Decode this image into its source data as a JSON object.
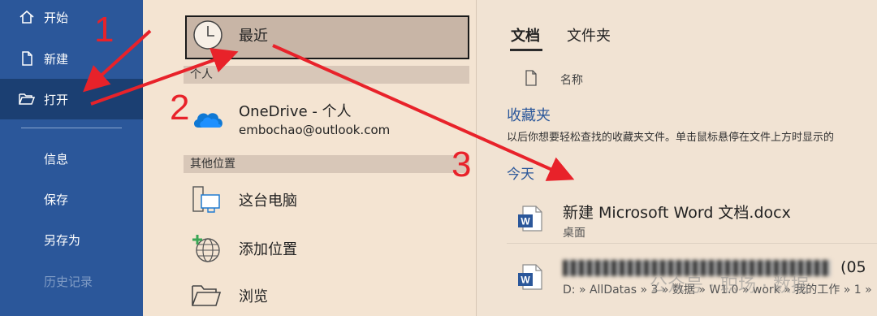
{
  "sidebar": {
    "items": [
      {
        "label": "开始",
        "icon": "home-icon"
      },
      {
        "label": "新建",
        "icon": "new-document-icon"
      },
      {
        "label": "打开",
        "icon": "open-folder-icon",
        "active": true
      }
    ],
    "sub_items": [
      {
        "label": "信息"
      },
      {
        "label": "保存"
      },
      {
        "label": "另存为"
      },
      {
        "label": "历史记录",
        "disabled": true
      }
    ]
  },
  "locations": {
    "recent_label": "最近",
    "personal_header": "个人",
    "onedrive": {
      "label": "OneDrive - 个人",
      "account": "embochao@outlook.com"
    },
    "other_header": "其他位置",
    "this_pc": "这台电脑",
    "add_place": "添加位置",
    "browse": "浏览"
  },
  "right": {
    "tabs": [
      "文档",
      "文件夹"
    ],
    "column_name": "名称",
    "favorites_title": "收藏夹",
    "favorites_desc": "以后你想要轻松查找的收藏夹文件。单击鼠标悬停在文件上方时显示的",
    "today_title": "今天",
    "files": [
      {
        "name": "新建 Microsoft Word 文档.docx",
        "location": "桌面",
        "icon": "word-file-icon"
      },
      {
        "name": "(05",
        "location": "D: » AllDatas » 3 » 数据 » W1.0 » work » 我的工作 » 1 » ",
        "icon": "word-file-icon",
        "blurred": true
      }
    ]
  },
  "annotations": [
    "1",
    "2",
    "3"
  ],
  "watermark": "公众号 · 职场 · 数据",
  "colors": {
    "sidebar": "#2b579a",
    "sidebar_active": "#1b3f72",
    "accent_red": "#e8222a",
    "link_blue": "#2b579a"
  }
}
